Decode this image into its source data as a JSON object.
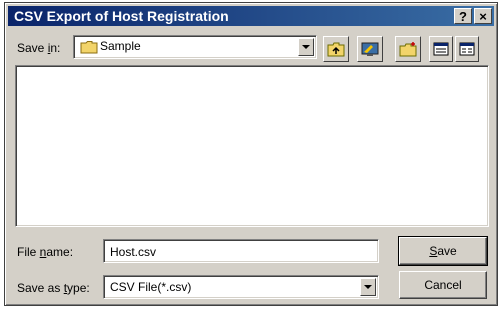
{
  "window": {
    "title": "CSV Export of Host Registration",
    "help_glyph": "?",
    "close_glyph": "×"
  },
  "save_in": {
    "label_pre": "Save ",
    "label_key": "i",
    "label_post": "n:",
    "value": "Sample",
    "icon": "folder-icon"
  },
  "toolbar": {
    "icons": [
      "up-folder-icon",
      "desktop-icon",
      "new-folder-icon",
      "list-view-icon"
    ]
  },
  "file_name": {
    "label_pre": "File ",
    "label_key": "n",
    "label_post": "ame:",
    "value": "Host.csv"
  },
  "save_as_type": {
    "label_pre": "Save as ",
    "label_key": "t",
    "label_post": "ype:",
    "value": "CSV File(*.csv)"
  },
  "buttons": {
    "save_key": "S",
    "save_rest": "ave",
    "cancel": "Cancel"
  },
  "colors": {
    "titlebar_start": "#0a246a",
    "titlebar_end": "#3a6ea5",
    "face": "#d4d0c8"
  }
}
